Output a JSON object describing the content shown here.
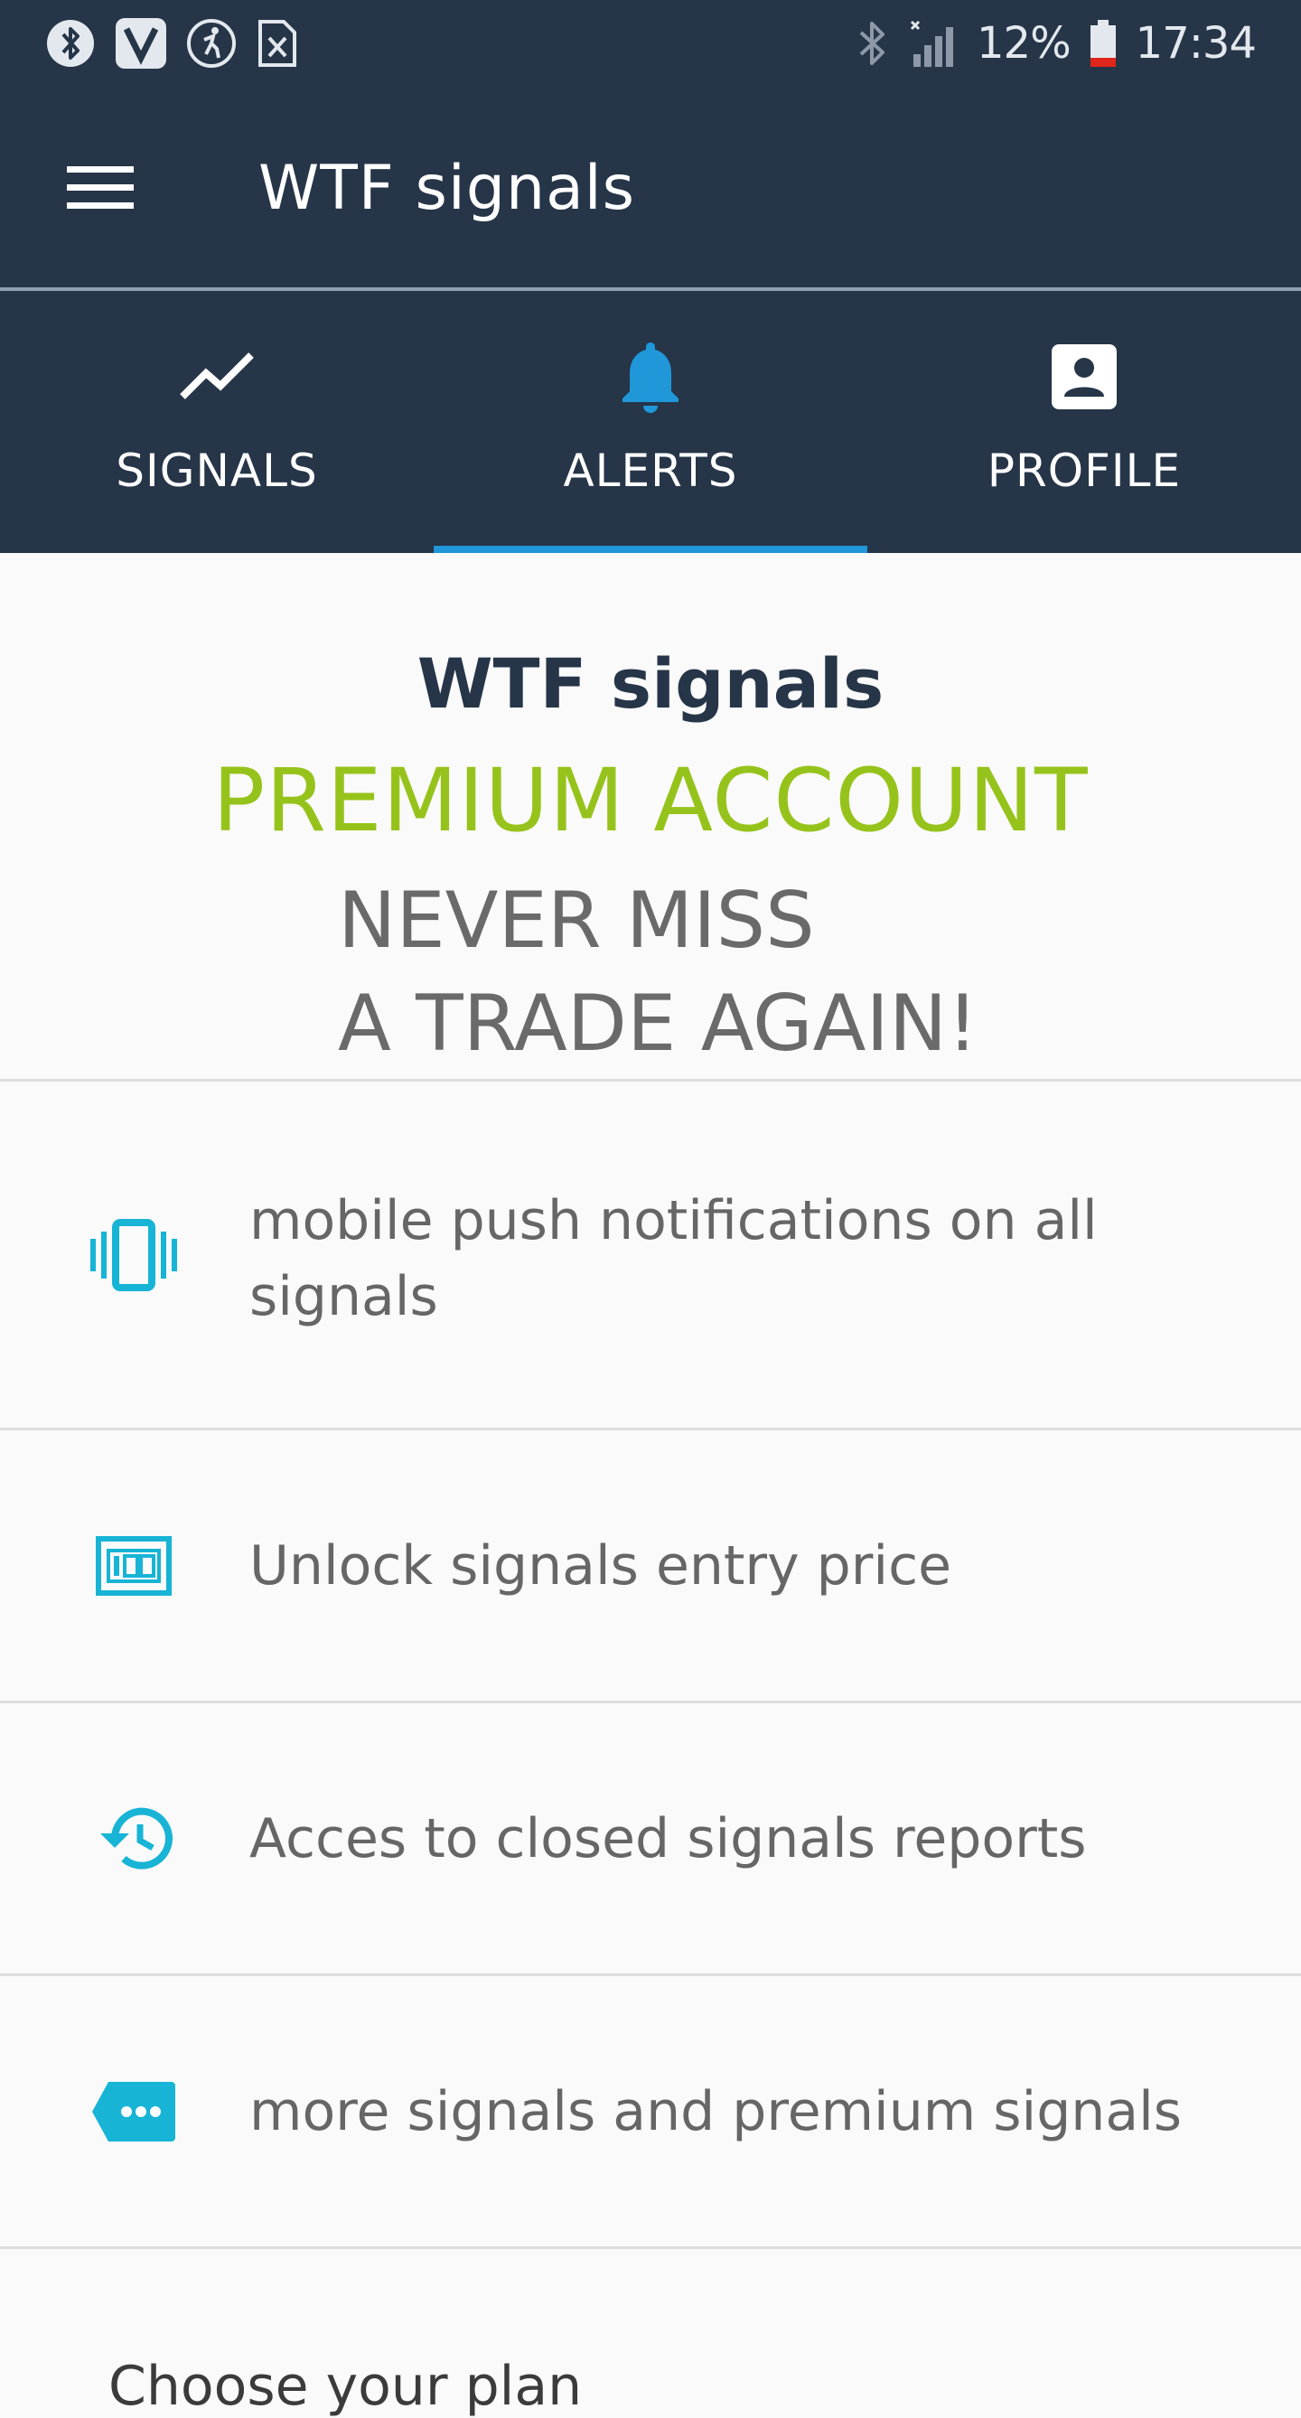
{
  "status_bar": {
    "battery": "12%",
    "time": "17:34",
    "left_icons": [
      "bluetooth-icon",
      "v-app-icon",
      "fitness-icon",
      "sheet-icon"
    ],
    "right_icons": [
      "bluetooth-icon",
      "signal-icon",
      "battery-icon"
    ]
  },
  "app_bar": {
    "title": "WTF signals",
    "menu_icon": "hamburger-menu-icon"
  },
  "tabs": [
    {
      "label": "SIGNALS",
      "icon": "trending-line-icon",
      "active": false
    },
    {
      "label": "ALERTS",
      "icon": "bell-icon",
      "active": true
    },
    {
      "label": "PROFILE",
      "icon": "contact-card-icon",
      "active": false
    }
  ],
  "hero": {
    "brand": "WTF signals",
    "premium": "PREMIUM ACCOUNT",
    "tagline_line1": "NEVER MISS",
    "tagline_line2": "A TRADE AGAIN!"
  },
  "features": [
    {
      "text": "mobile push notifications on all signals",
      "icon": "vibrate-icon"
    },
    {
      "text": "Unlock signals entry price",
      "icon": "price-100-icon"
    },
    {
      "text": "Acces to closed signals reports",
      "icon": "history-icon"
    },
    {
      "text": "more signals and premium signals",
      "icon": "label-more-icon"
    }
  ],
  "plan_heading": "Choose your plan",
  "colors": {
    "header_bg": "#263548",
    "accent_blue": "#1f97d8",
    "premium_green": "#96c31b",
    "icon_cyan": "#17b4d6"
  }
}
